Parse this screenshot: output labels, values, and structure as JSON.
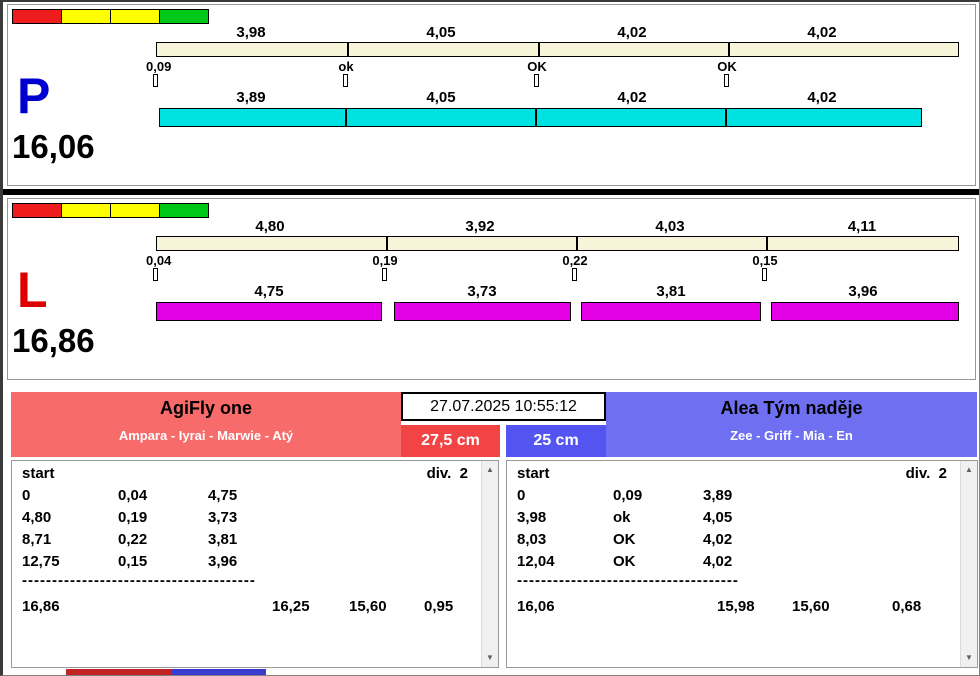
{
  "lane_p": {
    "letter": "P",
    "total": "16,06",
    "split_times": [
      "3,98",
      "4,05",
      "4,02",
      "4,02"
    ],
    "exchange_labels": [
      "0,09",
      "ok",
      "OK",
      "OK"
    ],
    "run_times": [
      "3,89",
      "4,05",
      "4,02",
      "4,02"
    ]
  },
  "lane_l": {
    "letter": "L",
    "total": "16,86",
    "split_times": [
      "4,80",
      "3,92",
      "4,03",
      "4,11"
    ],
    "exchange_labels": [
      "0,04",
      "0,19",
      "0,22",
      "0,15"
    ],
    "run_times": [
      "4,75",
      "3,73",
      "3,81",
      "3,96"
    ]
  },
  "footer": {
    "timestamp": "27.07.2025 10:55:12",
    "team_left": {
      "name": "AgiFly one",
      "members": "Ampara - Iyrai - Marwie - Atý",
      "jump_height": "27,5 cm"
    },
    "team_right": {
      "name": "Alea Tým naděje",
      "members": "Zee - Griff - Mia - En",
      "jump_height": "25 cm"
    },
    "results_left": {
      "header_left": "start",
      "header_right": "div.  2",
      "rows": [
        {
          "c1": "0",
          "c2": "0,04",
          "c3": "4,75"
        },
        {
          "c1": "4,80",
          "c2": "0,19",
          "c3": "3,73"
        },
        {
          "c1": "8,71",
          "c2": "0,22",
          "c3": "3,81"
        },
        {
          "c1": "12,75",
          "c2": "0,15",
          "c3": "3,96"
        }
      ],
      "separator": "---------------------------------------",
      "totals": {
        "t1": "16,86",
        "t2": "16,25",
        "t3": "15,60",
        "t4": "0,95"
      }
    },
    "results_right": {
      "header_left": "start",
      "header_right": "div.  2",
      "rows": [
        {
          "c1": "0",
          "c2": "0,09",
          "c3": "3,89"
        },
        {
          "c1": "3,98",
          "c2": "ok",
          "c3": "4,05"
        },
        {
          "c1": "8,03",
          "c2": "OK",
          "c3": "4,02"
        },
        {
          "c1": "12,04",
          "c2": "OK",
          "c3": "4,02"
        }
      ],
      "separator": "-------------------------------------",
      "totals": {
        "t1": "16,06",
        "t2": "15,98",
        "t3": "15,60",
        "t4": "0,68"
      }
    }
  },
  "scrollbar": {
    "up_glyph": "▲",
    "down_glyph": "▼"
  },
  "colors": {
    "lane_p_letter": "#0000d0",
    "lane_l_letter": "#dd0000",
    "reference_bar": "#f7f4da",
    "run_bar_p": "#00e1e1",
    "run_bar_l": "#e501e5",
    "status_red": "#ee1c1c",
    "status_yellow": "#ffff00",
    "status_green": "#00c818",
    "team_left_bg": "#f76b6b",
    "team_right_bg": "#6f6ff2",
    "height_left_bg": "#f24444",
    "height_right_bg": "#5454f0"
  }
}
